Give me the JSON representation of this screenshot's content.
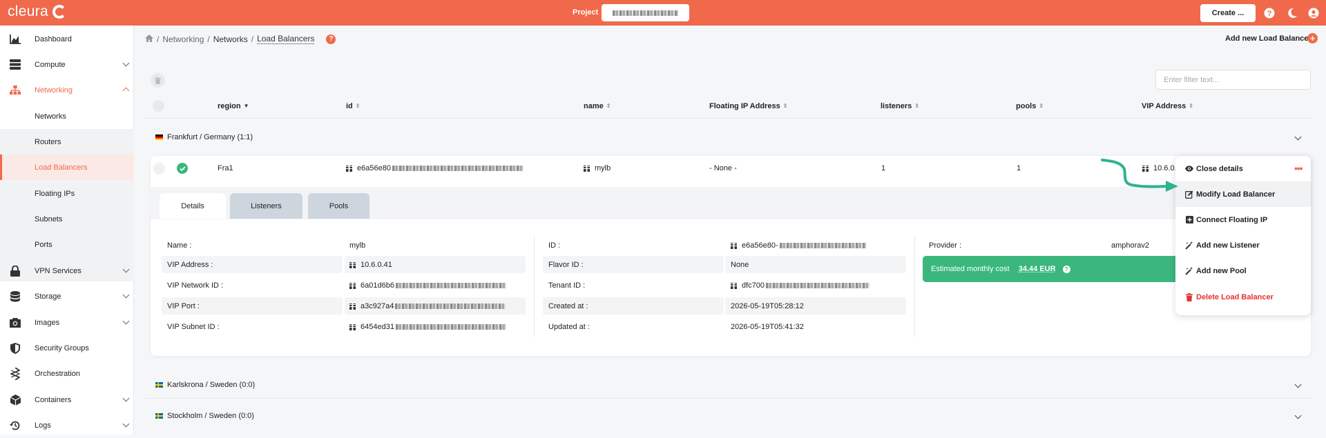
{
  "app": {
    "logo": "cleura",
    "project_label": "Project",
    "create_label": "Create ..."
  },
  "sidebar": {
    "items": [
      {
        "label": "Dashboard"
      },
      {
        "label": "Compute"
      },
      {
        "label": "Networking"
      },
      {
        "label": "VPN Services"
      },
      {
        "label": "Storage"
      },
      {
        "label": "Images"
      },
      {
        "label": "Security Groups"
      },
      {
        "label": "Orchestration"
      },
      {
        "label": "Containers"
      },
      {
        "label": "Logs"
      }
    ],
    "subitems": [
      {
        "label": "Networks"
      },
      {
        "label": "Routers"
      },
      {
        "label": "Load Balancers"
      },
      {
        "label": "Floating IPs"
      },
      {
        "label": "Subnets"
      },
      {
        "label": "Ports"
      }
    ]
  },
  "breadcrumb": {
    "items": [
      "Networking",
      "Networks",
      "Load Balancers"
    ]
  },
  "header": {
    "add_new": "Add new Load Balancer"
  },
  "filter": {
    "placeholder": "Enter filter text..."
  },
  "table": {
    "columns": [
      "region",
      "id",
      "name",
      "Floating IP Address",
      "listeners",
      "pools",
      "VIP Address"
    ],
    "regions": [
      {
        "label": "Frankfurt / Germany (1:1)"
      },
      {
        "label": "Karlskrona / Sweden (0:0)"
      },
      {
        "label": "Stockholm / Sweden (0:0)"
      }
    ],
    "row": {
      "region": "Fra1",
      "id_prefix": "e6a56e80",
      "name": "mylb",
      "floating_ip": "- None -",
      "listeners": "1",
      "pools": "1",
      "vip_partial": "10.6.0."
    }
  },
  "tabs": [
    "Details",
    "Listeners",
    "Pools"
  ],
  "details": {
    "left": [
      {
        "label": "Name :",
        "value": "mylb"
      },
      {
        "label": "VIP Address :",
        "value": "10.6.0.41"
      },
      {
        "label": "VIP Network ID :",
        "value": "6a01d6b6"
      },
      {
        "label": "VIP Port :",
        "value": "a3c927a4"
      },
      {
        "label": "VIP Subnet ID :",
        "value": "6454ed31"
      }
    ],
    "middle": [
      {
        "label": "ID :",
        "value": "e6a56e80-"
      },
      {
        "label": "Flavor ID :",
        "value": "None"
      },
      {
        "label": "Tenant ID :",
        "value": "dfc700"
      },
      {
        "label": "Created at :",
        "value": "2026-05-19T05:28:12"
      },
      {
        "label": "Updated at :",
        "value": "2026-05-19T05:41:32"
      }
    ],
    "provider_label": "Provider :",
    "provider_value": "amphorav2",
    "cost_label": "Estimated monthly cost",
    "cost_value": "34.44 EUR"
  },
  "menu": {
    "items": [
      {
        "label": "Close details"
      },
      {
        "label": "Modify Load Balancer"
      },
      {
        "label": "Connect Floating IP"
      },
      {
        "label": "Add new Listener"
      },
      {
        "label": "Add new Pool"
      },
      {
        "label": "Delete Load Balancer"
      }
    ]
  },
  "colors": {
    "brand": "#f0694a",
    "success": "#3bb77e",
    "danger": "#e3342f",
    "arrow": "#2fb38f"
  }
}
